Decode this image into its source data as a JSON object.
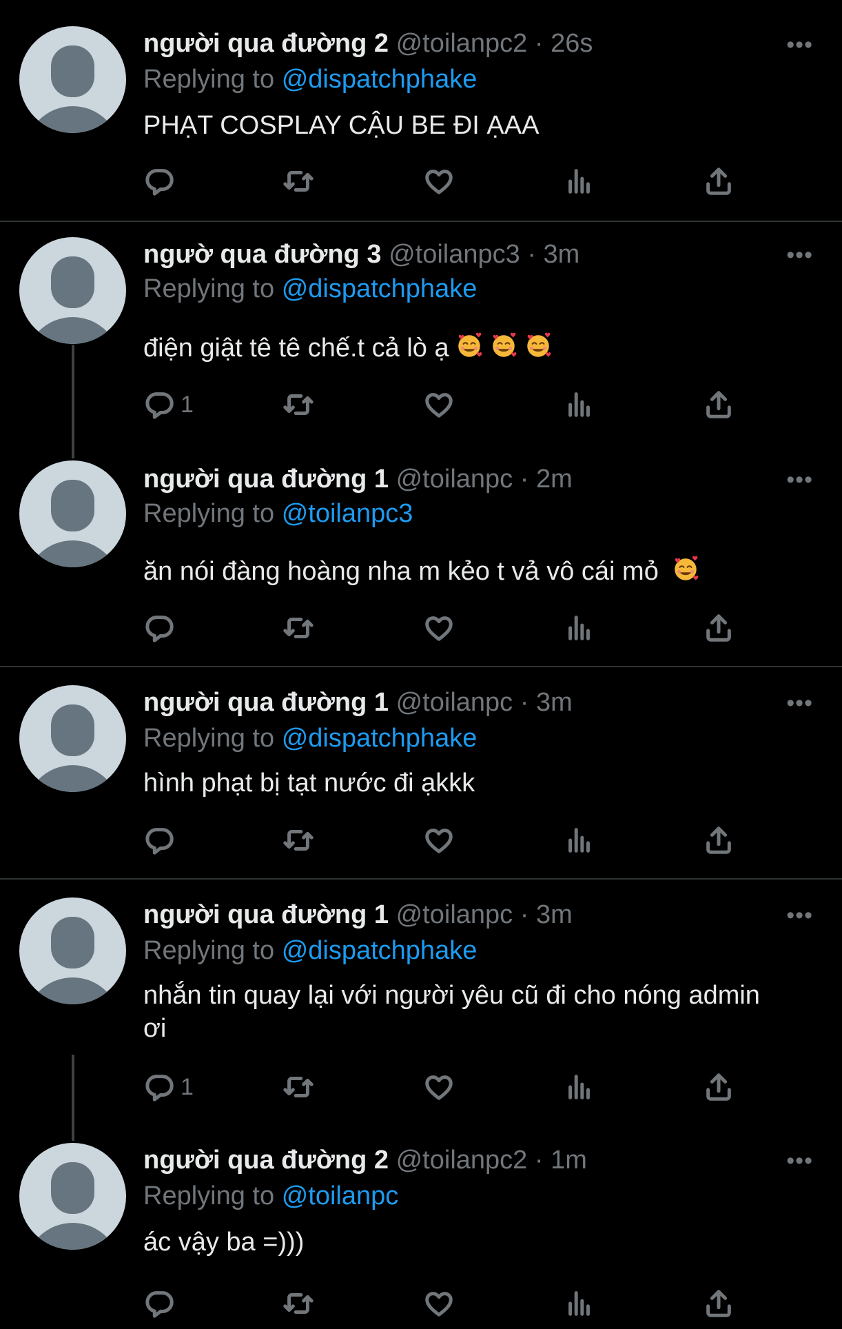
{
  "tweets": [
    {
      "name": "người qua đường 2",
      "handle": "@toilanpc2",
      "time": "· 26s",
      "replying_prefix": "Replying to",
      "mention": "@dispatchphake",
      "text": "PHẠT COSPLAY CẬU BE ĐI ẠAA",
      "emoji_count": 0,
      "reply_count": "",
      "more": "•••"
    },
    {
      "name": "ngườ qua đường 3",
      "handle": "@toilanpc3",
      "time": "· 3m",
      "replying_prefix": "Replying to",
      "mention": "@dispatchphake",
      "text": " điện giật tê tê chế.t cả lò ạ",
      "emoji_count": 3,
      "reply_count": "1",
      "more": "•••"
    },
    {
      "name": "người qua đường 1",
      "handle": "@toilanpc",
      "time": "· 2m",
      "replying_prefix": "Replying to",
      "mention": "@toilanpc3",
      "text": "ăn nói đàng hoàng nha m kẻo t vả vô cái mỏ",
      "emoji_count": 1,
      "reply_count": "",
      "more": "•••"
    },
    {
      "name": "người qua đường 1",
      "handle": "@toilanpc",
      "time": "· 3m",
      "replying_prefix": "Replying to",
      "mention": "@dispatchphake",
      "text": "hình phạt bị tạt nước đi ạkkk",
      "emoji_count": 0,
      "reply_count": "",
      "more": "•••"
    },
    {
      "name": "người qua đường 1",
      "handle": "@toilanpc",
      "time": "· 3m",
      "replying_prefix": "Replying to",
      "mention": "@dispatchphake",
      "text": "nhắn tin quay lại với người yêu cũ đi cho nóng admin ơi",
      "emoji_count": 0,
      "reply_count": "1",
      "more": "•••"
    },
    {
      "name": "người qua đường 2",
      "handle": "@toilanpc2",
      "time": "· 1m",
      "replying_prefix": "Replying to",
      "mention": "@toilanpc",
      "text": "ác vậy ba =)))",
      "emoji_count": 0,
      "reply_count": "",
      "more": "•••"
    }
  ],
  "icons": {
    "reply": "reply-icon",
    "retweet": "retweet-icon",
    "like": "heart-icon",
    "analytics": "analytics-icon",
    "share": "share-icon",
    "emoji": "smiling-face-with-hearts-emoji"
  },
  "colors": {
    "background": "#000000",
    "mention": "#1d9bf0",
    "muted": "#71767b",
    "text": "#e7e9ea",
    "avatar_bg": "#ccd6dd",
    "avatar_fg": "#66757f"
  }
}
